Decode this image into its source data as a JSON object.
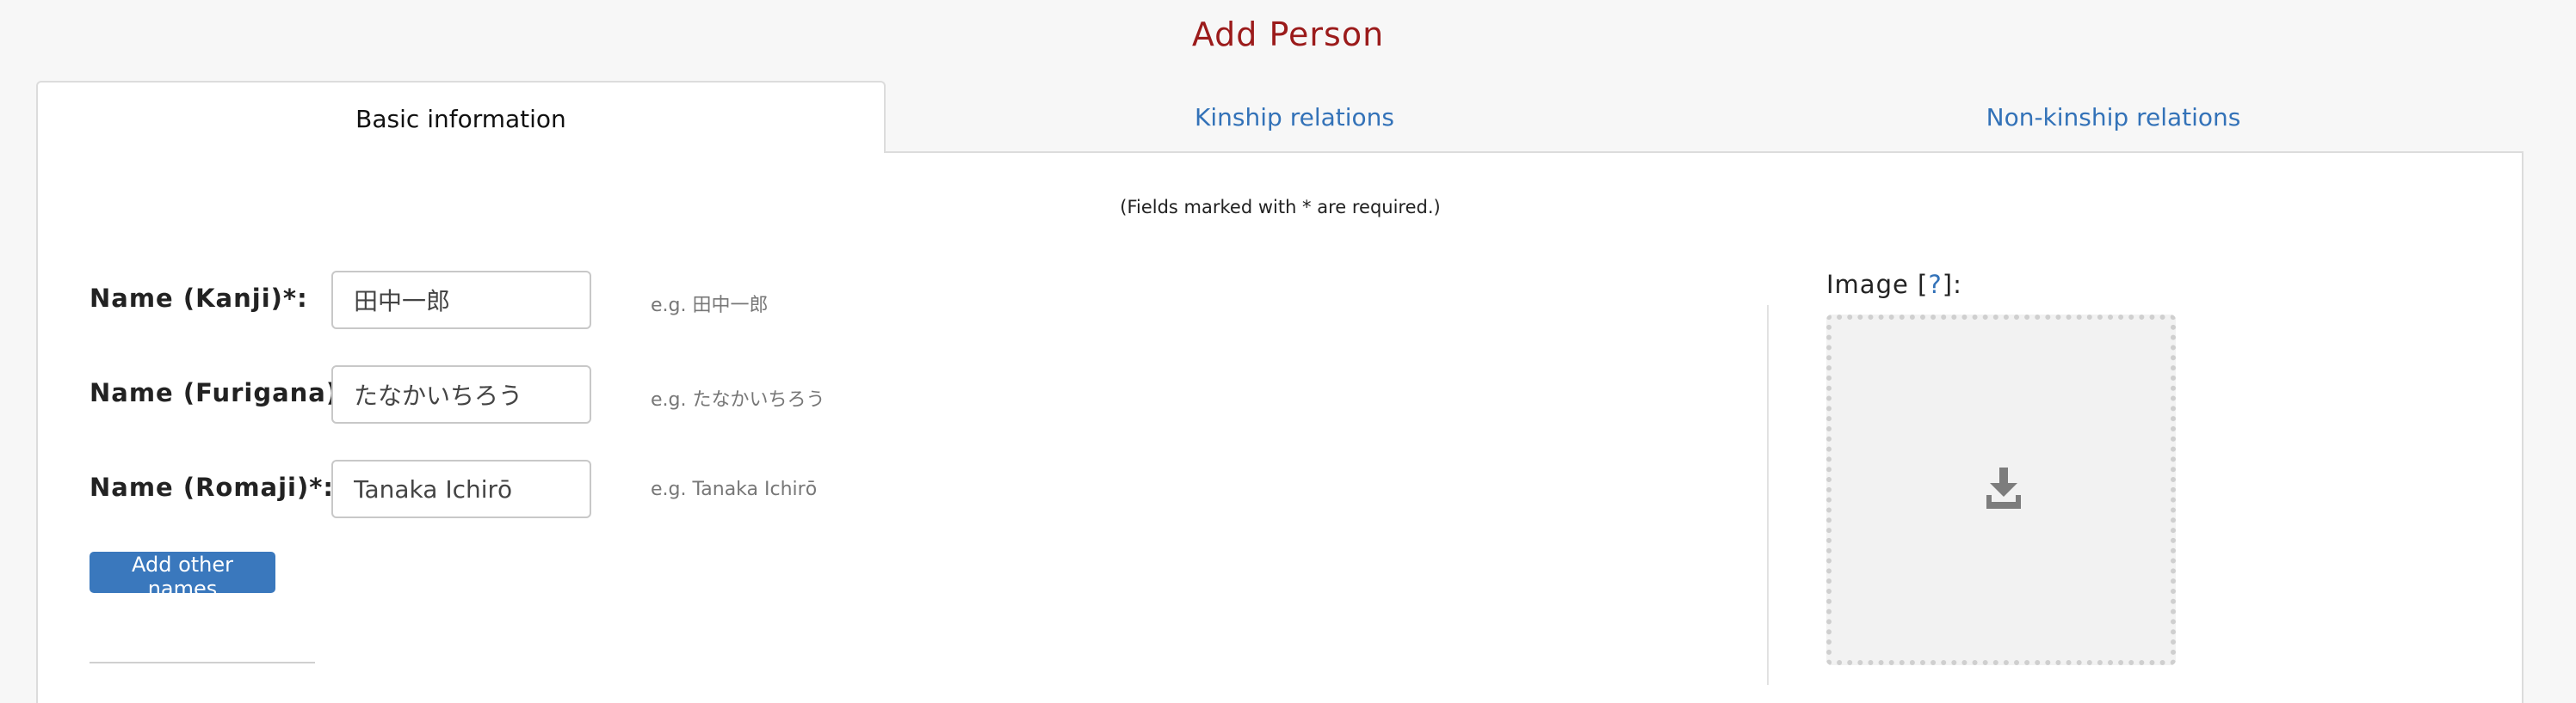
{
  "page": {
    "title": "Add Person"
  },
  "tabs": [
    {
      "label": "Basic information",
      "active": true
    },
    {
      "label": "Kinship relations",
      "active": false
    },
    {
      "label": "Non-kinship relations",
      "active": false
    }
  ],
  "form": {
    "required_note": "(Fields marked with * are required.)",
    "fields": [
      {
        "label": "Name (Kanji)*:",
        "value": "田中一郎",
        "example": "e.g. 田中一郎"
      },
      {
        "label": "Name (Furigana)*:",
        "value": "たなかいちろう",
        "example": "e.g. たなかいちろう"
      },
      {
        "label": "Name (Romaji)*:",
        "value": "Tanaka Ichirō",
        "example": "e.g. Tanaka Ichirō"
      }
    ],
    "add_names_button": "Add other names"
  },
  "image": {
    "label_prefix": "Image [",
    "help_link": "?",
    "label_suffix": "]:",
    "icon": "download-icon"
  },
  "colors": {
    "title": "#9b1b1b",
    "link": "#3372b8",
    "button": "#3a78bd"
  }
}
